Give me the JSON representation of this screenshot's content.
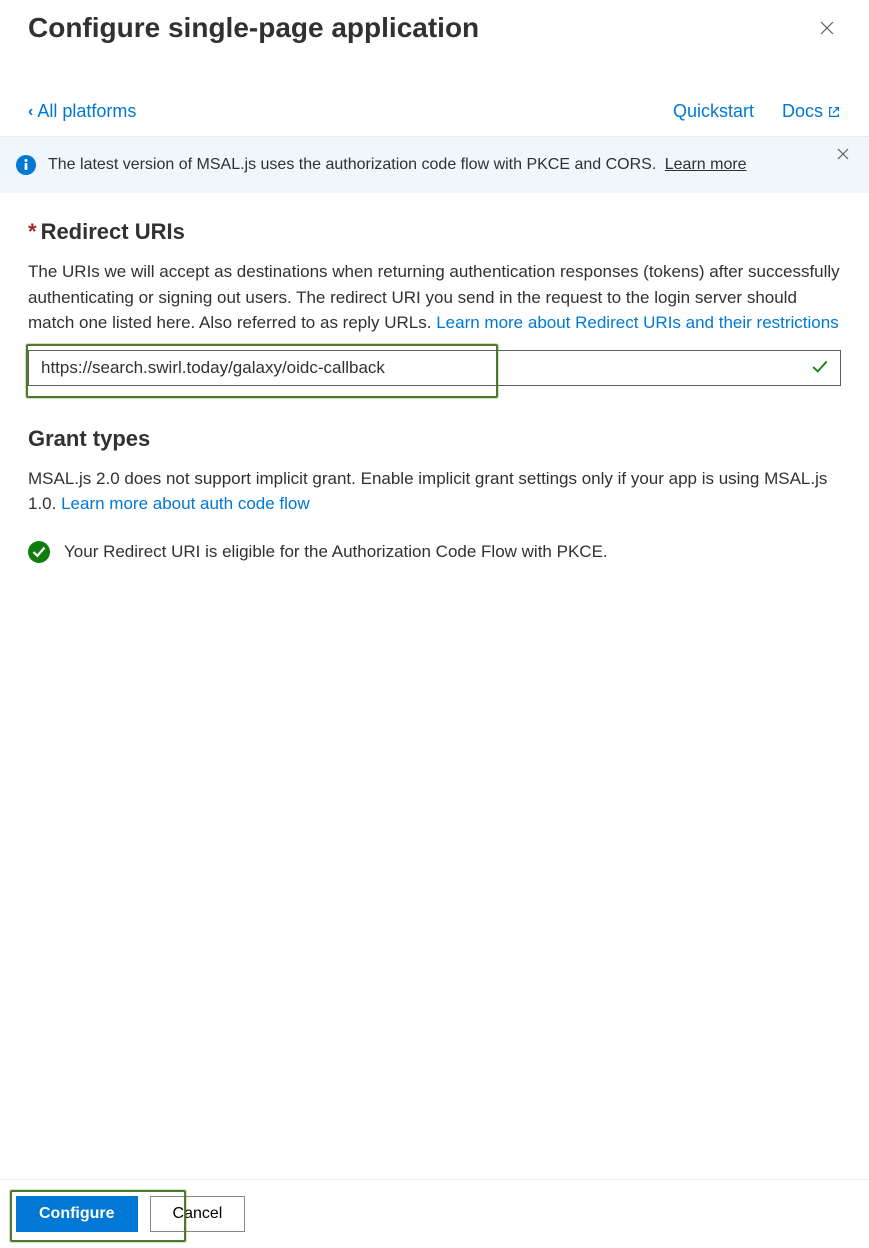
{
  "header": {
    "title": "Configure single-page application"
  },
  "nav": {
    "back_label": "All platforms",
    "quickstart_label": "Quickstart",
    "docs_label": "Docs"
  },
  "banner": {
    "text": "The latest version of MSAL.js uses the authorization code flow with PKCE and CORS.",
    "learn_more": "Learn more"
  },
  "redirect": {
    "heading": "Redirect URIs",
    "description": "The URIs we will accept as destinations when returning authentication responses (tokens) after successfully authenticating or signing out users. The redirect URI you send in the request to the login server should match one listed here. Also referred to as reply URLs. ",
    "learn_link": "Learn more about Redirect URIs and their restrictions",
    "uri_value": "https://search.swirl.today/galaxy/oidc-callback"
  },
  "grant": {
    "heading": "Grant types",
    "description": "MSAL.js 2.0 does not support implicit grant. Enable implicit grant settings only if your app is using MSAL.js 1.0. ",
    "learn_link": "Learn more about auth code flow",
    "eligible_text": "Your Redirect URI is eligible for the Authorization Code Flow with PKCE."
  },
  "footer": {
    "configure_label": "Configure",
    "cancel_label": "Cancel"
  }
}
